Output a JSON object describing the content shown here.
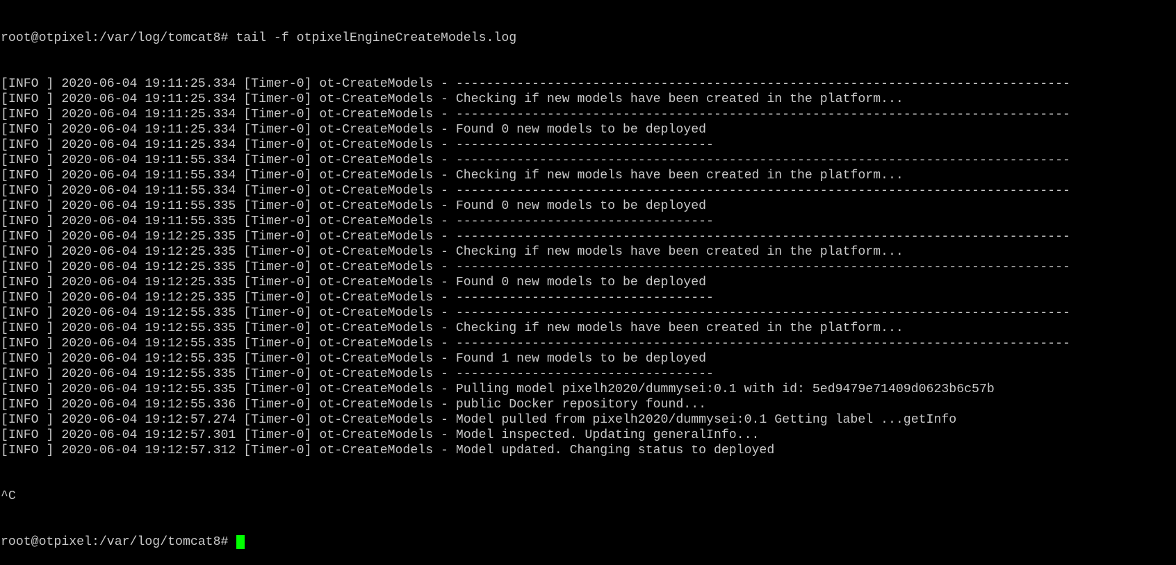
{
  "terminal": {
    "command_prompt": "root@otpixel:/var/log/tomcat8# ",
    "command": "tail -f otpixelEngineCreateModels.log",
    "log_lines": [
      "[INFO ] 2020-06-04 19:11:25.334 [Timer-0] ot-CreateModels - ---------------------------------------------------------------------------------",
      "[INFO ] 2020-06-04 19:11:25.334 [Timer-0] ot-CreateModels - Checking if new models have been created in the platform...",
      "[INFO ] 2020-06-04 19:11:25.334 [Timer-0] ot-CreateModels - ---------------------------------------------------------------------------------",
      "[INFO ] 2020-06-04 19:11:25.334 [Timer-0] ot-CreateModels - Found 0 new models to be deployed",
      "[INFO ] 2020-06-04 19:11:25.334 [Timer-0] ot-CreateModels - ----------------------------------",
      "[INFO ] 2020-06-04 19:11:55.334 [Timer-0] ot-CreateModels - ---------------------------------------------------------------------------------",
      "[INFO ] 2020-06-04 19:11:55.334 [Timer-0] ot-CreateModels - Checking if new models have been created in the platform...",
      "[INFO ] 2020-06-04 19:11:55.334 [Timer-0] ot-CreateModels - ---------------------------------------------------------------------------------",
      "[INFO ] 2020-06-04 19:11:55.335 [Timer-0] ot-CreateModels - Found 0 new models to be deployed",
      "[INFO ] 2020-06-04 19:11:55.335 [Timer-0] ot-CreateModels - ----------------------------------",
      "[INFO ] 2020-06-04 19:12:25.335 [Timer-0] ot-CreateModels - ---------------------------------------------------------------------------------",
      "[INFO ] 2020-06-04 19:12:25.335 [Timer-0] ot-CreateModels - Checking if new models have been created in the platform...",
      "[INFO ] 2020-06-04 19:12:25.335 [Timer-0] ot-CreateModels - ---------------------------------------------------------------------------------",
      "[INFO ] 2020-06-04 19:12:25.335 [Timer-0] ot-CreateModels - Found 0 new models to be deployed",
      "[INFO ] 2020-06-04 19:12:25.335 [Timer-0] ot-CreateModels - ----------------------------------",
      "[INFO ] 2020-06-04 19:12:55.335 [Timer-0] ot-CreateModels - ---------------------------------------------------------------------------------",
      "[INFO ] 2020-06-04 19:12:55.335 [Timer-0] ot-CreateModels - Checking if new models have been created in the platform...",
      "[INFO ] 2020-06-04 19:12:55.335 [Timer-0] ot-CreateModels - ---------------------------------------------------------------------------------",
      "[INFO ] 2020-06-04 19:12:55.335 [Timer-0] ot-CreateModels - Found 1 new models to be deployed",
      "[INFO ] 2020-06-04 19:12:55.335 [Timer-0] ot-CreateModels - ----------------------------------",
      "[INFO ] 2020-06-04 19:12:55.335 [Timer-0] ot-CreateModels - Pulling model pixelh2020/dummysei:0.1 with id: 5ed9479e71409d0623b6c57b",
      "[INFO ] 2020-06-04 19:12:55.336 [Timer-0] ot-CreateModels - public Docker repository found...",
      "[INFO ] 2020-06-04 19:12:57.274 [Timer-0] ot-CreateModels - Model pulled from pixelh2020/dummysei:0.1 Getting label ...getInfo",
      "[INFO ] 2020-06-04 19:12:57.301 [Timer-0] ot-CreateModels - Model inspected. Updating generalInfo...",
      "[INFO ] 2020-06-04 19:12:57.312 [Timer-0] ot-CreateModels - Model updated. Changing status to deployed"
    ],
    "interrupt_line": "^C",
    "final_prompt": "root@otpixel:/var/log/tomcat8# ",
    "text_color": "#c8c8c8",
    "background_color": "#000000",
    "cursor_color": "#00ff00"
  }
}
